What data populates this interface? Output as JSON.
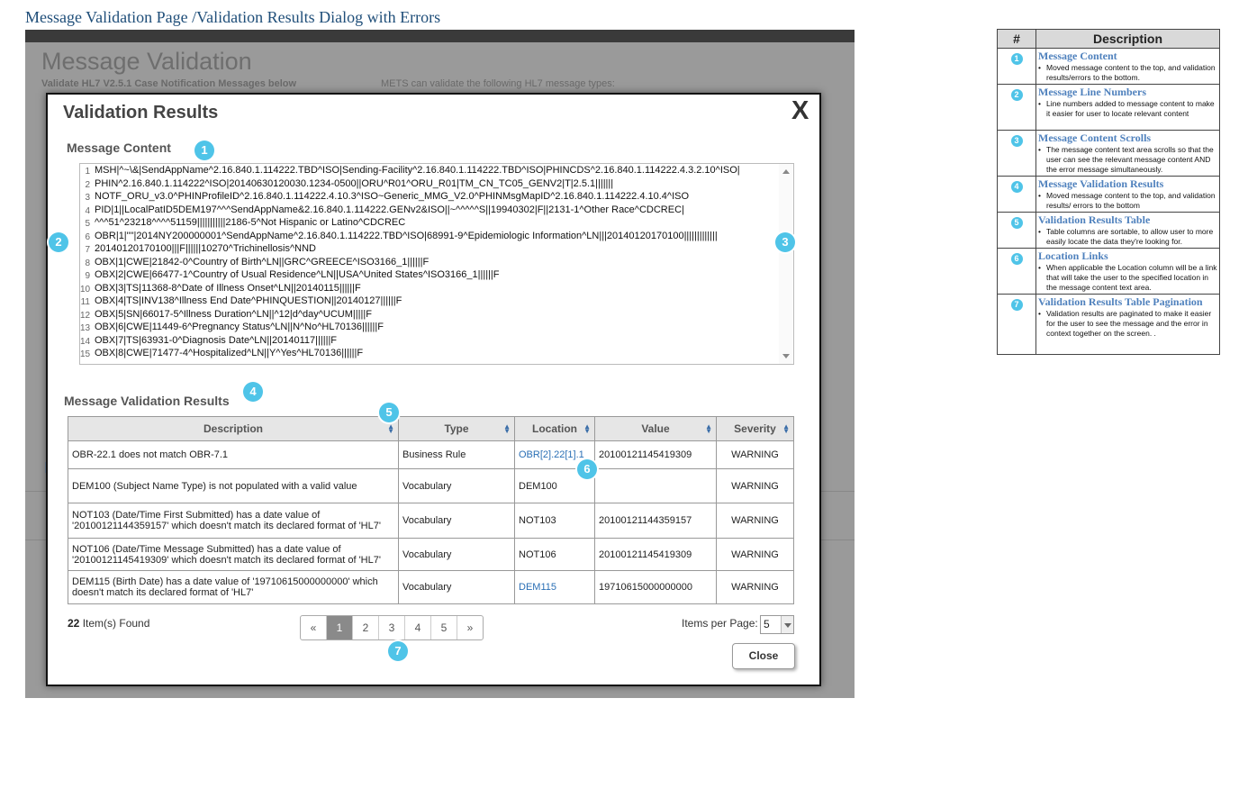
{
  "doc_title": "Message Validation Page /Validation Results Dialog with Errors",
  "background": {
    "heading": "Message Validation",
    "sub_left": "Validate HL7 V2.5.1 Case Notification Messages below",
    "sub_right": "METS can validate the following HL7 message types:"
  },
  "dialog": {
    "title": "Validation Results",
    "close_icon": "X",
    "message_content_label": "Message Content",
    "message_lines": [
      {
        "num": "1",
        "text": "MSH|^~\\&|SendAppName^2.16.840.1.114222.TBD^ISO|Sending-Facility^2.16.840.1.114222.TBD^ISO|PHINCDS^2.16.840.1.114222.4.3.2.10^ISO|"
      },
      {
        "num": "2",
        "text": "PHIN^2.16.840.1.114222^ISO|20140630120030.1234-0500||ORU^R01^ORU_R01|TM_CN_TC05_GENV2|T|2.5.1|||||||"
      },
      {
        "num": "3",
        "text": "NOTF_ORU_v3.0^PHINProfileID^2.16.840.1.114222.4.10.3^ISO~Generic_MMG_V2.0^PHINMsgMapID^2.16.840.1.114222.4.10.4^ISO"
      },
      {
        "num": "4",
        "text": "PID|1||LocalPatID5DEM197^^^SendAppName&2.16.840.1.114222.GENv2&ISO||~^^^^^S||19940302|F||2131-1^Other Race^CDCREC|"
      },
      {
        "num": "5",
        "text": "^^^51^23218^^^^51159|||||||||||2186-5^Not Hispanic or Latino^CDCREC"
      },
      {
        "num": "6",
        "text": "OBR|1|\"\"|2014NY200000001^SendAppName^2.16.840.1.114222.TBD^ISO|68991-9^Epidemiologic Information^LN|||20140120170100|||||||||||||"
      },
      {
        "num": "7",
        "text": "20140120170100|||F||||||10270^Trichinellosis^NND"
      },
      {
        "num": "8",
        "text": "OBX|1|CWE|21842-0^Country of Birth^LN||GRC^GREECE^ISO3166_1||||||F"
      },
      {
        "num": "9",
        "text": "OBX|2|CWE|66477-1^Country of Usual Residence^LN||USA^United States^ISO3166_1||||||F"
      },
      {
        "num": "10",
        "text": "OBX|3|TS|11368-8^Date of Illness Onset^LN||20140115||||||F"
      },
      {
        "num": "11",
        "text": "OBX|4|TS|INV138^Illness End Date^PHINQUESTION||20140127||||||F"
      },
      {
        "num": "12",
        "text": "OBX|5|SN|66017-5^Illness Duration^LN||^12|d^day^UCUM|||||F"
      },
      {
        "num": "13",
        "text": "OBX|6|CWE|11449-6^Pregnancy Status^LN||N^No^HL70136||||||F"
      },
      {
        "num": "14",
        "text": "OBX|7|TS|63931-0^Diagnosis Date^LN||20140117||||||F"
      },
      {
        "num": "15",
        "text": "OBX|8|CWE|71477-4^Hospitalized^LN||Y^Yes^HL70136||||||F"
      }
    ],
    "results_label": "Message Validation Results",
    "table": {
      "headers": [
        "Description",
        "Type",
        "Location",
        "Value",
        "Severity"
      ],
      "rows": [
        {
          "description": "OBR-22.1 does not match OBR-7.1",
          "type": "Business Rule",
          "location": "OBR[2].22[1].1",
          "location_link": true,
          "value": "20100121145419309",
          "severity": "WARNING"
        },
        {
          "description": "DEM100 (Subject Name Type) is not populated with a valid value",
          "type": "Vocabulary",
          "location": "DEM100",
          "location_link": false,
          "value": "",
          "severity": "WARNING"
        },
        {
          "description": "NOT103 (Date/Time First Submitted) has a date value of '20100121144359157' which doesn't match its declared format of 'HL7'",
          "type": "Vocabulary",
          "location": "NOT103",
          "location_link": false,
          "value": "20100121144359157",
          "severity": "WARNING"
        },
        {
          "description": "NOT106 (Date/Time Message Submitted) has a date value of '20100121145419309' which doesn't match its declared format of 'HL7'",
          "type": "Vocabulary",
          "location": "NOT106",
          "location_link": false,
          "value": "20100121145419309",
          "severity": "WARNING"
        },
        {
          "description": "DEM115 (Birth Date) has a date value of '19710615000000000' which doesn't match its declared format of 'HL7'",
          "type": "Vocabulary",
          "location": "DEM115",
          "location_link": true,
          "value": "19710615000000000",
          "severity": "WARNING"
        }
      ]
    },
    "items_found_count": "22",
    "items_found_suffix": " Item(s) Found",
    "pager": [
      "«",
      "1",
      "2",
      "3",
      "4",
      "5",
      "»"
    ],
    "pager_active": "1",
    "items_per_page_label": "Items per Page:",
    "items_per_page_value": "5",
    "close_button": "Close"
  },
  "callouts": [
    "1",
    "2",
    "3",
    "4",
    "5",
    "6",
    "7"
  ],
  "legend": {
    "header_num": "#",
    "header_desc": "Description",
    "rows": [
      {
        "num": "1",
        "title": "Message Content",
        "desc": "Moved message content to the top, and validation results/errors to the bottom."
      },
      {
        "num": "2",
        "title": "Message Line Numbers",
        "desc": "Line numbers added to message content to make it easier for user to locate relevant content"
      },
      {
        "num": "3",
        "title": "Message Content Scrolls",
        "desc": "The message content text area scrolls so that the user can see the relevant message content AND the error message simultaneously."
      },
      {
        "num": "4",
        "title": "Message Validation Results",
        "desc": "Moved message content to the top, and validation results/ errors to the bottom"
      },
      {
        "num": "5",
        "title": "Validation Results Table",
        "desc": "Table columns are sortable, to allow user to more easily locate the data they're looking for."
      },
      {
        "num": "6",
        "title": "Location Links",
        "desc": "When applicable the Location column will be a link that will take the user to the specified location in the message content text area."
      },
      {
        "num": "7",
        "title": "Validation Results Table Pagination",
        "desc": "Validation results are paginated to make it easier for the user to see the message and the error in context together on the screen.  ."
      }
    ]
  },
  "colors": {
    "callout": "#4fc4e8",
    "link": "#2a6fb5",
    "legend_title": "#4f81bd"
  }
}
